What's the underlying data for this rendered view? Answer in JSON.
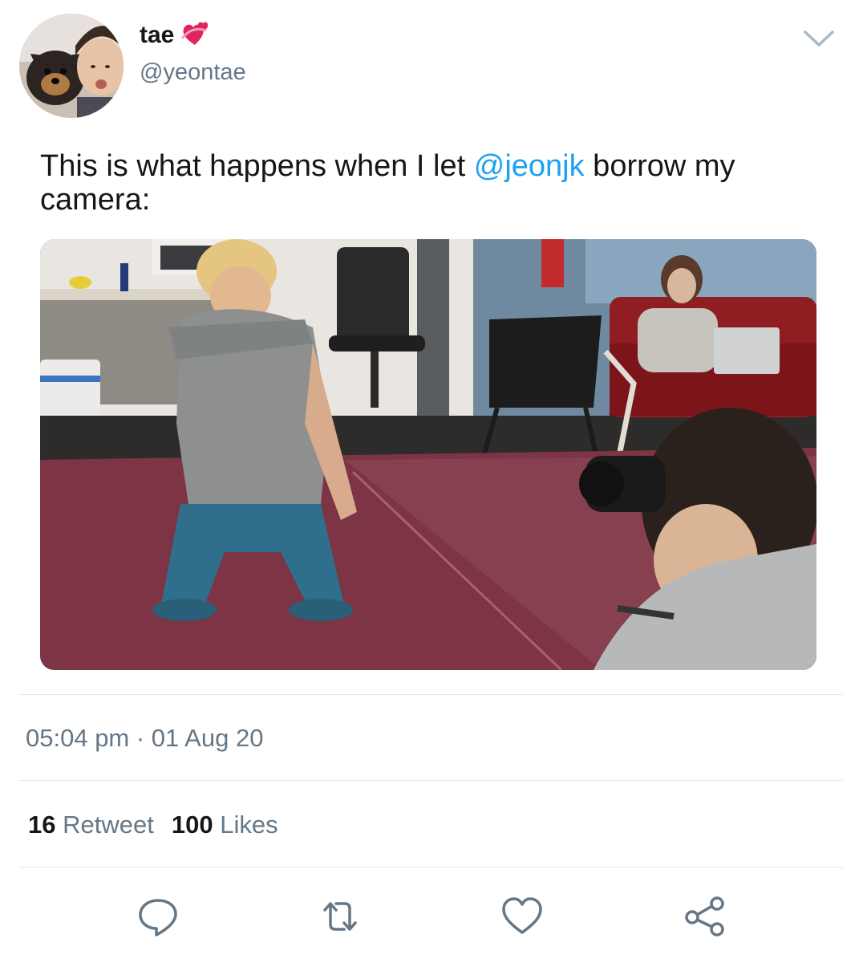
{
  "tweet": {
    "display_name": "tae",
    "name_emoji_icon": "revolving-hearts-icon",
    "handle": "@yeontae",
    "text_before": "This is what happens when I let ",
    "mention": "@jeonjk",
    "text_after": " borrow my camera:",
    "timestamp": "05:04 pm · 01 Aug 20"
  },
  "stats": {
    "retweets_count": "16",
    "retweets_label": "Retweet",
    "likes_count": "100",
    "likes_label": "Likes"
  },
  "actions": [
    {
      "icon": "reply-icon"
    },
    {
      "icon": "retweet-icon"
    },
    {
      "icon": "like-heart-icon"
    },
    {
      "icon": "share-icon"
    }
  ],
  "colors": {
    "link": "#1da1f2",
    "secondary_text": "#657786",
    "primary_text": "#14171a",
    "divider": "#e1e8ed",
    "heart_emoji": "#e0245e"
  }
}
